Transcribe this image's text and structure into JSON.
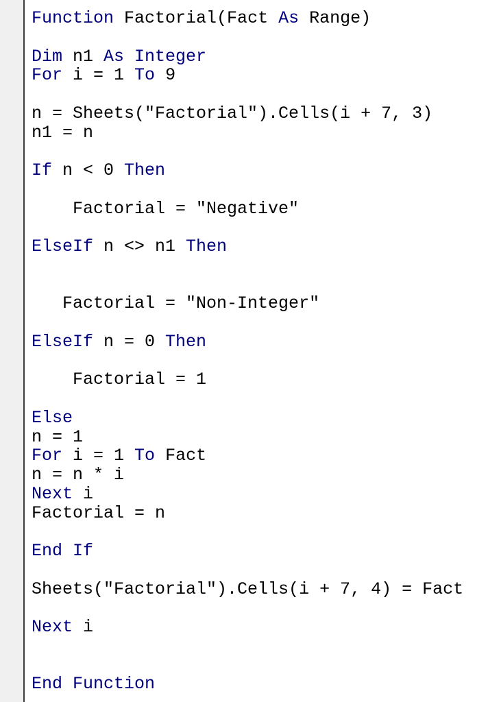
{
  "editor": {
    "keyword_color": "#00007F",
    "text_color": "#000000",
    "lines": [
      [
        {
          "k": "kw",
          "t": "Function"
        },
        {
          "k": "tx",
          "t": " Factorial(Fact "
        },
        {
          "k": "kw",
          "t": "As"
        },
        {
          "k": "tx",
          "t": " Range)"
        }
      ],
      [],
      [
        {
          "k": "kw",
          "t": "Dim"
        },
        {
          "k": "tx",
          "t": " n1 "
        },
        {
          "k": "kw",
          "t": "As Integer"
        }
      ],
      [
        {
          "k": "kw",
          "t": "For"
        },
        {
          "k": "tx",
          "t": " i = 1 "
        },
        {
          "k": "kw",
          "t": "To"
        },
        {
          "k": "tx",
          "t": " 9"
        }
      ],
      [],
      [
        {
          "k": "tx",
          "t": "n = Sheets(\"Factorial\").Cells(i + 7, 3)"
        }
      ],
      [
        {
          "k": "tx",
          "t": "n1 = n"
        }
      ],
      [],
      [
        {
          "k": "kw",
          "t": "If"
        },
        {
          "k": "tx",
          "t": " n < 0 "
        },
        {
          "k": "kw",
          "t": "Then"
        }
      ],
      [],
      [
        {
          "k": "tx",
          "t": "    Factorial = \"Negative\""
        }
      ],
      [],
      [
        {
          "k": "kw",
          "t": "ElseIf"
        },
        {
          "k": "tx",
          "t": " n <> n1 "
        },
        {
          "k": "kw",
          "t": "Then"
        }
      ],
      [],
      [],
      [
        {
          "k": "tx",
          "t": "   Factorial = \"Non-Integer\""
        }
      ],
      [],
      [
        {
          "k": "kw",
          "t": "ElseIf"
        },
        {
          "k": "tx",
          "t": " n = 0 "
        },
        {
          "k": "kw",
          "t": "Then"
        }
      ],
      [],
      [
        {
          "k": "tx",
          "t": "    Factorial = 1"
        }
      ],
      [],
      [
        {
          "k": "kw",
          "t": "Else"
        }
      ],
      [
        {
          "k": "tx",
          "t": "n = 1"
        }
      ],
      [
        {
          "k": "kw",
          "t": "For"
        },
        {
          "k": "tx",
          "t": " i = 1 "
        },
        {
          "k": "kw",
          "t": "To"
        },
        {
          "k": "tx",
          "t": " Fact"
        }
      ],
      [
        {
          "k": "tx",
          "t": "n = n * i"
        }
      ],
      [
        {
          "k": "kw",
          "t": "Next"
        },
        {
          "k": "tx",
          "t": " i"
        }
      ],
      [
        {
          "k": "tx",
          "t": "Factorial = n"
        }
      ],
      [],
      [
        {
          "k": "kw",
          "t": "End If"
        }
      ],
      [],
      [
        {
          "k": "tx",
          "t": "Sheets(\"Factorial\").Cells(i + 7, 4) = Fact"
        }
      ],
      [],
      [
        {
          "k": "kw",
          "t": "Next"
        },
        {
          "k": "tx",
          "t": " i"
        }
      ],
      [],
      [],
      [
        {
          "k": "kw",
          "t": "End Function"
        }
      ]
    ]
  }
}
